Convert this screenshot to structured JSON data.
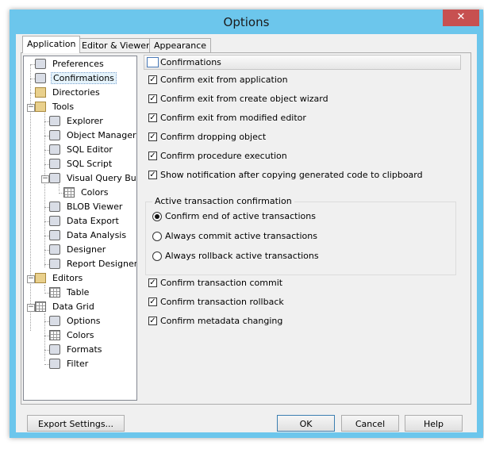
{
  "window": {
    "title": "Options",
    "close_glyph": "✕"
  },
  "tabs": [
    "Application",
    "Editor & Viewers",
    "Appearance"
  ],
  "tree": [
    {
      "label": "Preferences",
      "icon": "preferences-icon"
    },
    {
      "label": "Confirmations",
      "icon": "confirmations-icon"
    },
    {
      "label": "Directories",
      "icon": "directories-icon"
    },
    {
      "label": "Tools",
      "icon": "tools-icon"
    },
    {
      "label": "Explorer",
      "icon": "explorer-icon"
    },
    {
      "label": "Object Manager",
      "icon": "object-manager-icon"
    },
    {
      "label": "SQL Editor",
      "icon": "sql-editor-icon"
    },
    {
      "label": "SQL Script",
      "icon": "sql-script-icon"
    },
    {
      "label": "Visual Query Buil",
      "icon": "visual-query-builder-icon"
    },
    {
      "label": "Colors",
      "icon": "colors-icon"
    },
    {
      "label": "BLOB Viewer",
      "icon": "blob-viewer-icon"
    },
    {
      "label": "Data Export",
      "icon": "data-export-icon"
    },
    {
      "label": "Data Analysis",
      "icon": "data-analysis-icon"
    },
    {
      "label": "Designer",
      "icon": "designer-icon"
    },
    {
      "label": "Report Designer",
      "icon": "report-designer-icon"
    },
    {
      "label": "Editors",
      "icon": "editors-icon"
    },
    {
      "label": "Table",
      "icon": "table-icon"
    },
    {
      "label": "Data Grid",
      "icon": "data-grid-icon"
    },
    {
      "label": "Options",
      "icon": "options-icon"
    },
    {
      "label": "Colors",
      "icon": "colors-icon"
    },
    {
      "label": "Formats",
      "icon": "formats-icon"
    },
    {
      "label": "Filter",
      "icon": "filter-icon"
    }
  ],
  "selected_tree_item": "Confirmations",
  "panel_header": "Confirmations",
  "checkboxes_top": [
    {
      "label": "Confirm exit from application",
      "checked": true
    },
    {
      "label": "Confirm exit from create object wizard",
      "checked": true
    },
    {
      "label": "Confirm exit from modified editor",
      "checked": true
    },
    {
      "label": "Confirm dropping object",
      "checked": true
    },
    {
      "label": "Confirm procedure execution",
      "checked": true
    },
    {
      "label": "Show notification after copying generated code to clipboard",
      "checked": true
    }
  ],
  "active_transaction": {
    "title": "Active transaction confirmation",
    "options": [
      {
        "label": "Confirm end of active transactions",
        "selected": true
      },
      {
        "label": "Always commit active transactions",
        "selected": false
      },
      {
        "label": "Always rollback active transactions",
        "selected": false
      }
    ]
  },
  "checkboxes_bottom": [
    {
      "label": "Confirm transaction commit",
      "checked": true
    },
    {
      "label": "Confirm transaction rollback",
      "checked": true
    },
    {
      "label": "Confirm metadata changing",
      "checked": true
    }
  ],
  "check_glyph": "✓",
  "buttons": {
    "export": "Export Settings...",
    "ok": "OK",
    "cancel": "Cancel",
    "help": "Help"
  },
  "colors": {
    "frame": "#6cc6ec",
    "close": "#c75050"
  }
}
